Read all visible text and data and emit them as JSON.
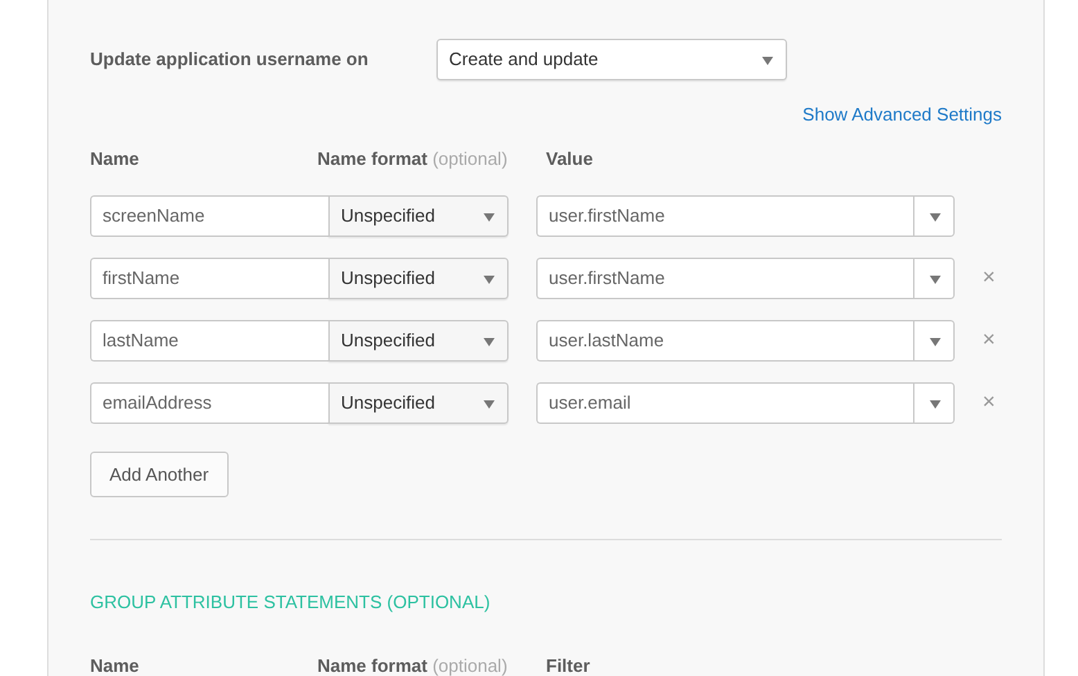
{
  "username_settings": [
    {
      "label": "Update application username on",
      "value": "Create and update"
    }
  ],
  "advanced_link": "Show Advanced Settings",
  "attribute_columns": {
    "name": "Name",
    "format": "Name format",
    "format_note": "(optional)",
    "value": "Value"
  },
  "attributes": [
    {
      "name": "screenName",
      "format": "Unspecified",
      "value": "user.firstName"
    },
    {
      "name": "firstName",
      "format": "Unspecified",
      "value": "user.firstName",
      "remove": "×"
    },
    {
      "name": "lastName",
      "format": "Unspecified",
      "value": "user.lastName",
      "remove": "×"
    },
    {
      "name": "emailAddress",
      "format": "Unspecified",
      "value": "user.email",
      "remove": "×"
    }
  ],
  "add_button": "Add Another",
  "group_section": {
    "title": "GROUP ATTRIBUTE STATEMENTS (OPTIONAL)",
    "columns": {
      "name": "Name",
      "format": "Name format",
      "format_note": "(optional)",
      "filter": "Filter"
    }
  }
}
